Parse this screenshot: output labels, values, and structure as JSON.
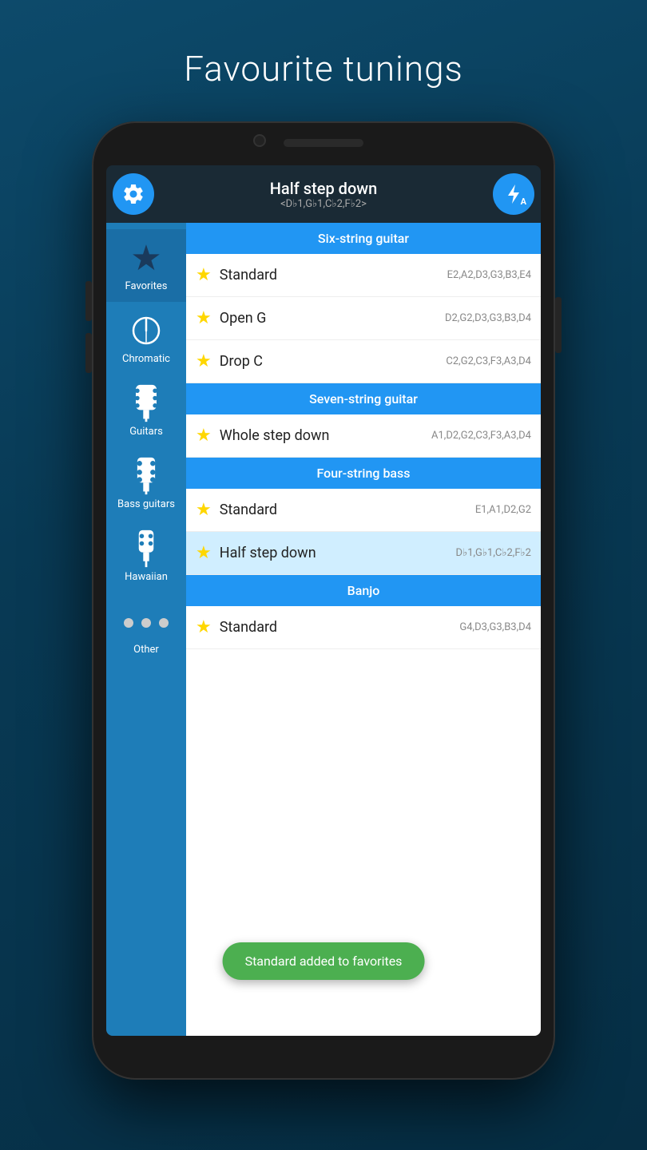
{
  "page": {
    "title": "Favourite tunings",
    "background_color": "#0d4a6b"
  },
  "topbar": {
    "settings_label": "Settings",
    "tuning_name": "Half step down",
    "tuning_notes": "<D♭1,G♭1,C♭2,F♭2>",
    "auto_label": "A"
  },
  "sidebar": {
    "items": [
      {
        "id": "favorites",
        "label": "Favorites",
        "active": true
      },
      {
        "id": "chromatic",
        "label": "Chromatic",
        "active": false
      },
      {
        "id": "guitars",
        "label": "Guitars",
        "active": false
      },
      {
        "id": "bass-guitars",
        "label": "Bass guitars",
        "active": false
      },
      {
        "id": "hawaiian",
        "label": "Hawaiian",
        "active": false
      },
      {
        "id": "other",
        "label": "Other",
        "active": false
      }
    ]
  },
  "sections": [
    {
      "id": "six-string-guitar",
      "header": "Six-string guitar",
      "items": [
        {
          "name": "Standard",
          "notes": "E2,A2,D3,G3,B3,E4",
          "starred": true,
          "highlighted": false
        },
        {
          "name": "Open G",
          "notes": "D2,G2,D3,G3,B3,D4",
          "starred": true,
          "highlighted": false
        },
        {
          "name": "Drop C",
          "notes": "C2,G2,C3,F3,A3,D4",
          "starred": true,
          "highlighted": false
        }
      ]
    },
    {
      "id": "seven-string-guitar",
      "header": "Seven-string guitar",
      "items": [
        {
          "name": "Whole step down",
          "notes": "A1,D2,G2,C3,F3,A3,D4",
          "starred": true,
          "highlighted": false
        }
      ]
    },
    {
      "id": "four-string-bass",
      "header": "Four-string bass",
      "items": [
        {
          "name": "Standard",
          "notes": "E1,A1,D2,G2",
          "starred": true,
          "highlighted": false
        },
        {
          "name": "Half step down",
          "notes": "D♭1,G♭1,C♭2,F♭2",
          "starred": true,
          "highlighted": true
        }
      ]
    },
    {
      "id": "banjo",
      "header": "Banjo",
      "items": [
        {
          "name": "Standard",
          "notes": "G4,D3,G3,B3,D4",
          "starred": true,
          "highlighted": false
        }
      ]
    }
  ],
  "toast": {
    "message": "Standard added to favorites"
  }
}
